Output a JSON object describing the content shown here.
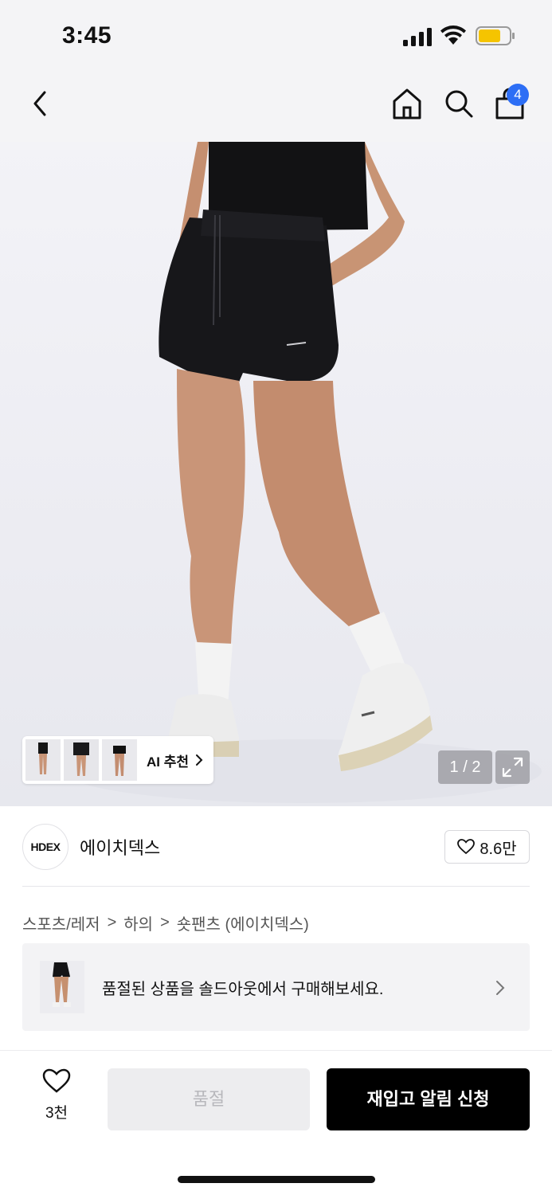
{
  "status_bar": {
    "time": "3:45"
  },
  "nav": {
    "back_icon": "chevron-left-icon",
    "home_icon": "home-icon",
    "search_icon": "search-icon",
    "bag_icon": "shopping-bag-icon",
    "bag_badge_count": "4",
    "badge_color": "#2d6ef5"
  },
  "hero": {
    "ai_recommend_label": "AI 추천",
    "page_counter": "1 / 2",
    "expand_icon": "expand-icon"
  },
  "brand": {
    "logo_text": "HDEX",
    "name": "에이치덱스",
    "like_count": "8.6만"
  },
  "breadcrumb": {
    "items": [
      "스포츠/레저",
      "하의",
      "숏팬츠 (에이치덱스)"
    ],
    "separator": ">"
  },
  "banner": {
    "text": "품절된 상품을 솔드아웃에서 구매해보세요."
  },
  "bottom_bar": {
    "wish_count": "3천",
    "soldout_label": "품절",
    "restock_label": "재입고 알림 신청"
  }
}
